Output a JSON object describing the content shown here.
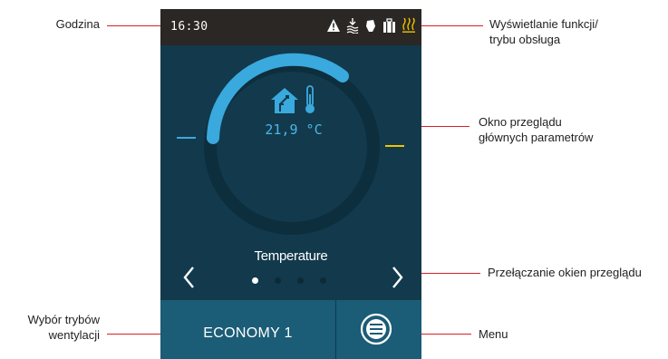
{
  "callouts": {
    "clock": "Godzina",
    "function_display": [
      "Wyświetlanie funkcji/",
      "trybu obsługa"
    ],
    "overview_window": [
      "Okno przeglądu",
      "głównych parametrów"
    ],
    "switch_views": "Przełączanie okien przeglądu",
    "mode_select": [
      "Wybór trybów",
      "wentylacji"
    ],
    "menu": "Menu"
  },
  "device": {
    "status_bar": {
      "time": "16:30",
      "icons": [
        "warning-icon",
        "defrost-icon",
        "boost-hand-icon",
        "away-luggage-icon",
        "heater-icon"
      ]
    },
    "overview": {
      "value": "21,9 °C",
      "title": "Temperature",
      "icons": [
        "house-temperature-icon",
        "thermometer-icon"
      ],
      "page_indicator": {
        "pages": 4,
        "active": 1
      }
    },
    "mode_button": {
      "label": "ECONOMY 1"
    },
    "menu_button": {
      "icon": "menu-icon"
    }
  },
  "colors": {
    "leader_line": "#d8202a",
    "screen_bg": "#123a4c",
    "status_bar_bg": "#2a2724",
    "accent_blue": "#3aa9de",
    "accent_yellow": "#f2c300",
    "bottom_bar_bg": "#1b5c76"
  }
}
